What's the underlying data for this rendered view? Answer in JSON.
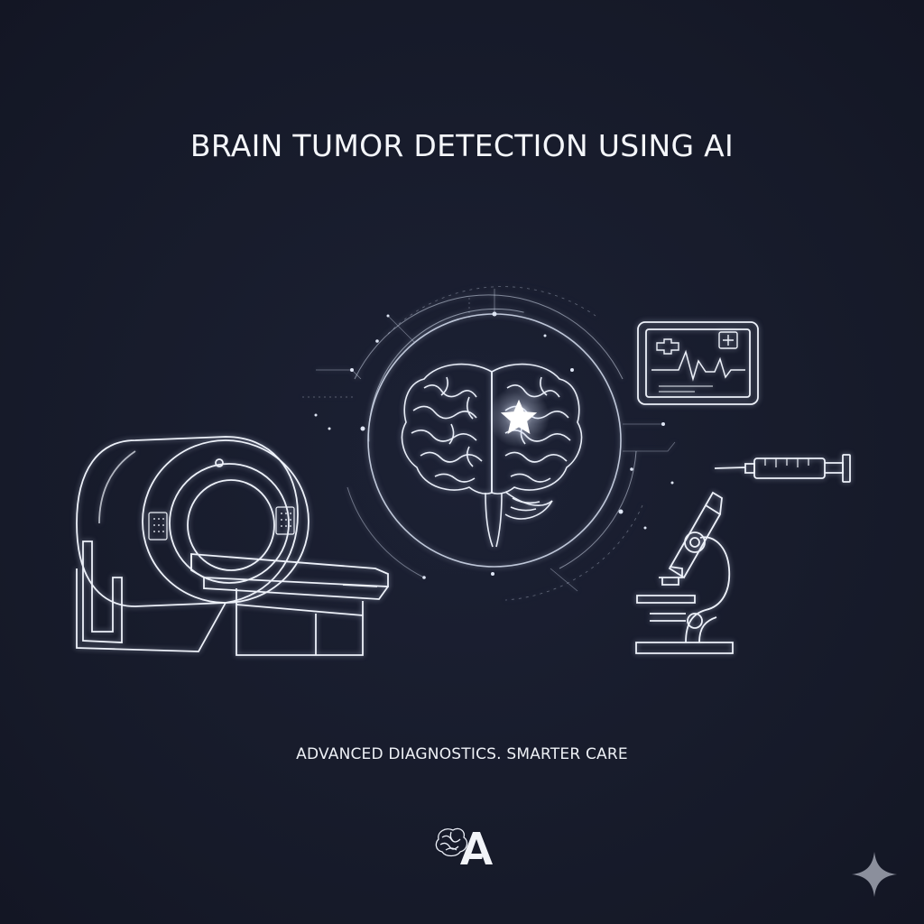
{
  "poster": {
    "title": "BRAIN TUMOR DETECTION USING AI",
    "tagline": "ADVANCED DIAGNOSTICS. SMARTER CARE"
  },
  "illustrations": [
    "mri-scanner-icon",
    "brain-icon",
    "tumor-highlight-icon",
    "vital-monitor-icon",
    "syringe-icon",
    "microscope-icon"
  ],
  "logo": "brain-a-logo",
  "colors": {
    "background": "#171b2b",
    "line": "#e6ecf7",
    "text": "#f4f6fa"
  }
}
